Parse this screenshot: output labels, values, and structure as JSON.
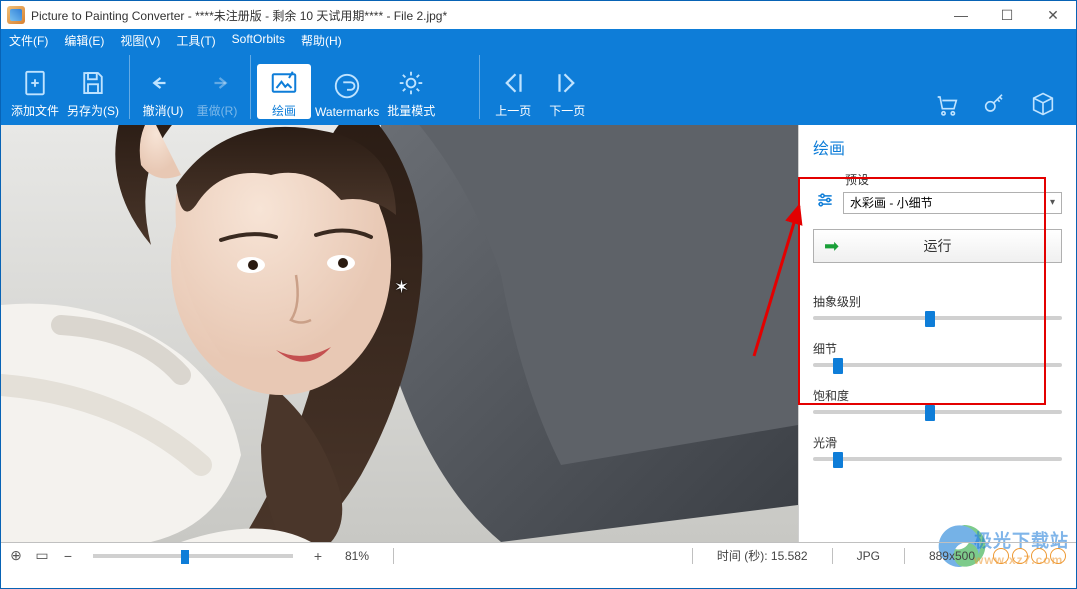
{
  "window": {
    "title": "Picture to Painting Converter - ****未注册版 - 剩余 10 天试用期**** - File 2.jpg*"
  },
  "menu": {
    "file": "文件(F)",
    "edit": "编辑(E)",
    "view": "视图(V)",
    "tools": "工具(T)",
    "softorbits": "SoftOrbits",
    "help": "帮助(H)"
  },
  "toolbar": {
    "add_file": "添加文件",
    "save_as": "另存为(S)",
    "undo": "撤消(U)",
    "redo": "重做(R)",
    "paint": "绘画",
    "watermarks": "Watermarks",
    "batch": "批量模式",
    "prev": "上一页",
    "next": "下一页"
  },
  "side": {
    "title": "绘画",
    "preset_label": "预设",
    "preset_value": "水彩画 - 小细节",
    "run": "运行",
    "sliders": {
      "abstract": "抽象级别",
      "detail": "细节",
      "saturation": "饱和度",
      "smooth": "光滑"
    },
    "slider_pos": {
      "abstract": 45,
      "detail": 8,
      "saturation": 45,
      "smooth": 8
    }
  },
  "status": {
    "zoom": "81%",
    "time_label": "时间 (秒):",
    "time_value": "15.582",
    "format": "JPG",
    "dims": "889x500"
  },
  "watermark": {
    "main": "极光下载站",
    "sub": "www.xz7.com"
  }
}
